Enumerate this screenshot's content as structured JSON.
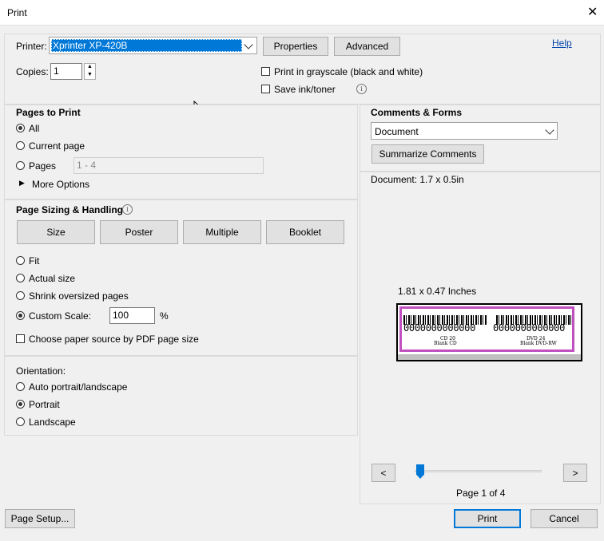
{
  "window": {
    "title": "Print"
  },
  "printer": {
    "label": "Printer:",
    "selected": "Xprinter XP-420B",
    "properties_label": "Properties",
    "advanced_label": "Advanced",
    "help_label": "Help",
    "copies_label": "Copies:",
    "copies_value": "1",
    "grayscale_label": "Print in grayscale (black and white)",
    "save_ink_label": "Save ink/toner"
  },
  "pages_to_print": {
    "header": "Pages to Print",
    "options": [
      "All",
      "Current page",
      "Pages"
    ],
    "selected": "All",
    "pages_range_placeholder": "1 - 4",
    "more_options_label": "More Options"
  },
  "sizing": {
    "header": "Page Sizing & Handling",
    "buttons": [
      "Size",
      "Poster",
      "Multiple",
      "Booklet"
    ],
    "options": [
      "Fit",
      "Actual size",
      "Shrink oversized pages",
      "Custom Scale:"
    ],
    "selected": "Custom Scale:",
    "scale_value": "100",
    "scale_unit": "%",
    "paper_source_label": "Choose paper source by PDF page size"
  },
  "orientation": {
    "header": "Orientation:",
    "options": [
      "Auto portrait/landscape",
      "Portrait",
      "Landscape"
    ],
    "selected": "Portrait"
  },
  "comments_forms": {
    "header": "Comments & Forms",
    "selected": "Document",
    "summarize_label": "Summarize Comments"
  },
  "preview": {
    "document_size": "Document: 1.7 x 0.5in",
    "paper_size": "1.81 x 0.47 Inches",
    "label_left_barcode": "0000000000000",
    "label_left_line1": "CD 20",
    "label_left_line2": "Blank CD",
    "label_right_barcode": "0000000000000",
    "label_right_line1": "DVD 24",
    "label_right_line2": "Blank DVD-RW",
    "prev_label": "<",
    "next_label": ">",
    "page_indicator": "Page 1 of 4",
    "slider_fraction": 0.0
  },
  "footer": {
    "page_setup_label": "Page Setup...",
    "print_label": "Print",
    "cancel_label": "Cancel"
  },
  "colors": {
    "accent": "#0078d7",
    "label_border": "#c050c0",
    "selection": "#0078d7"
  }
}
